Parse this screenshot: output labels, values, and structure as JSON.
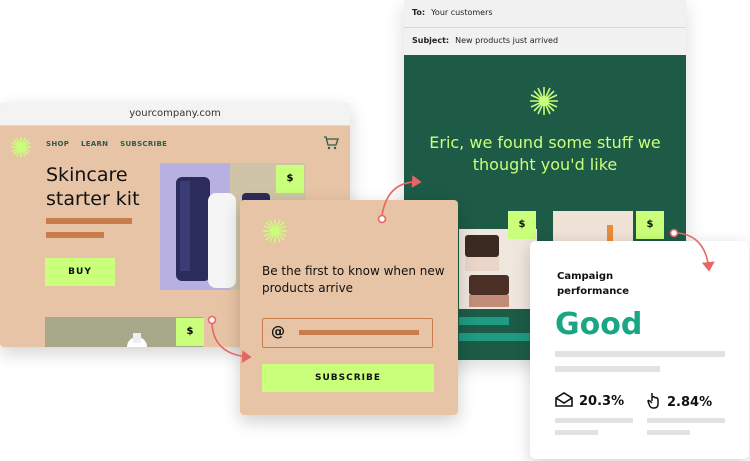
{
  "colors": {
    "peach": "#e8c4a6",
    "lime": "#c9ff7a",
    "dark_green": "#1d5b46",
    "accent_teal": "#1aa584",
    "copper": "#c87d4c",
    "arrow": "#e66565"
  },
  "website": {
    "url": "yourcompany.com",
    "nav": [
      "SHOP",
      "LEARN",
      "SUBSCRIBE"
    ],
    "heading": "Skincare starter kit",
    "buy_label": "BUY",
    "price_tag": "$",
    "price_tag_2": "$",
    "icons": [
      "sun-logo-icon",
      "cart-icon"
    ]
  },
  "signup": {
    "title": "Be the first to know when new products arrive",
    "input_icon": "@",
    "subscribe_label": "SUBSCRIBE"
  },
  "email": {
    "to_label": "To:",
    "to_value": "Your customers",
    "subject_label": "Subject:",
    "subject_value": "New products just arrived",
    "greeting": "Eric, we found some stuff we thought you'd like",
    "price_a": "$",
    "price_b": "$"
  },
  "performance": {
    "title": "Campaign performance",
    "rating": "Good",
    "open_rate": "20.3%",
    "click_rate": "2.84%",
    "icons": [
      "envelope-open-icon",
      "cursor-hand-icon"
    ]
  }
}
